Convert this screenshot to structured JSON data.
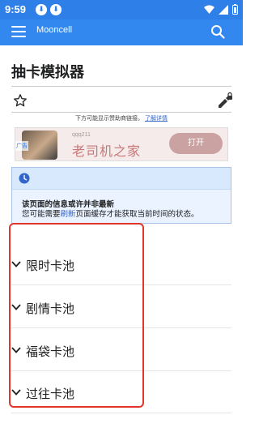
{
  "status_bar": {
    "time": "9:59",
    "notifications": [
      "download-icon",
      "download-icon"
    ],
    "system_icons": [
      "wifi-icon",
      "signal-icon",
      "battery-icon"
    ]
  },
  "app_bar": {
    "title": "Mooncell",
    "color": "#3388f0"
  },
  "page": {
    "title": "抽卡模拟器"
  },
  "ad_notice": {
    "text": "下方可能显示赞助商链接。",
    "link": "了解详情"
  },
  "ad": {
    "label": "广告",
    "account": "qqq211",
    "headline": "老司机之家",
    "button": "打开"
  },
  "notice": {
    "title": "该页面的信息或许并非最新",
    "body_prefix": "您可能需要",
    "body_link": "刷新",
    "body_suffix": "页面缓存才能获取当前时间的状态。"
  },
  "sections": [
    {
      "label": "限时卡池"
    },
    {
      "label": "剧情卡池"
    },
    {
      "label": "福袋卡池"
    },
    {
      "label": "过往卡池"
    }
  ],
  "colors": {
    "accent": "#3388f0",
    "link": "#3366cc",
    "highlight_box": "#e0362b"
  }
}
